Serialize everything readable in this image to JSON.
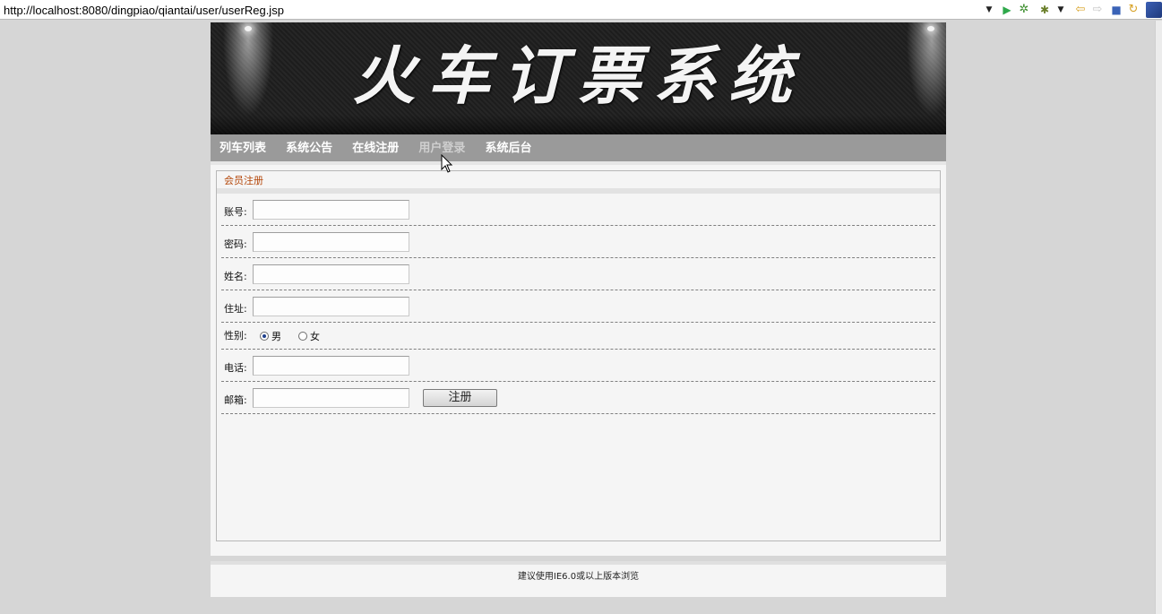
{
  "browser": {
    "url": "http://localhost:8080/dingpiao/qiantai/user/userReg.jsp",
    "toolbar_icons": [
      "dropdown-icon",
      "run-icon",
      "debug-icon",
      "external-tools-icon",
      "back-icon",
      "forward-icon",
      "stop-icon",
      "refresh-icon",
      "perspective-icon"
    ]
  },
  "banner": {
    "title": "火车订票系统"
  },
  "nav": {
    "items": [
      {
        "label": "列车列表"
      },
      {
        "label": "系统公告"
      },
      {
        "label": "在线注册"
      },
      {
        "label": "用户登录"
      },
      {
        "label": "系统后台"
      }
    ]
  },
  "panel": {
    "title": "会员注册"
  },
  "form": {
    "account_label": "账号:",
    "account_value": "",
    "password_label": "密码:",
    "password_value": "",
    "name_label": "姓名:",
    "name_value": "",
    "address_label": "住址:",
    "address_value": "",
    "gender_label": "性别:",
    "gender_options": [
      "男",
      "女"
    ],
    "gender_selected": "男",
    "phone_label": "电话:",
    "phone_value": "",
    "email_label": "邮箱:",
    "email_value": "",
    "submit_label": "注册"
  },
  "footer": {
    "note": "建议使用IE6.0或以上版本浏览"
  }
}
